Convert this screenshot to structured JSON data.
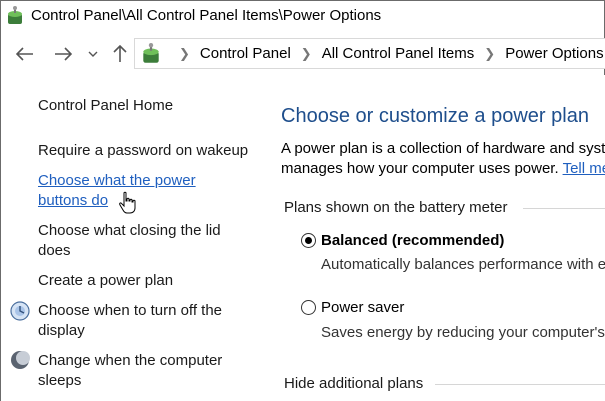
{
  "window": {
    "title": "Control Panel\\All Control Panel Items\\Power Options"
  },
  "navigation": {
    "back_icon": "arrow-left-icon",
    "forward_icon": "arrow-right-icon",
    "recent_icon": "chevron-down-icon",
    "up_icon": "arrow-up-icon"
  },
  "addressbar": {
    "icon": "control-panel-icon",
    "crumbs": [
      "Control Panel",
      "All Control Panel Items",
      "Power Options"
    ]
  },
  "sidebar": {
    "home": "Control Panel Home",
    "items": [
      {
        "label": "Require a password on wakeup"
      },
      {
        "label_lines": [
          "Choose what the power",
          "buttons do"
        ]
      },
      {
        "label_lines": [
          "Choose what closing the lid",
          "does"
        ]
      },
      {
        "label": "Create a power plan"
      },
      {
        "label_lines": [
          "Choose when to turn off the",
          "display"
        ],
        "icon": "display-icon"
      },
      {
        "label_lines": [
          "Change when the computer",
          "sleeps"
        ],
        "icon": "moon-icon"
      }
    ]
  },
  "main": {
    "heading": "Choose or customize a power plan",
    "description_line1": "A power plan is a collection of hardware and syst",
    "description_line2": "manages how your computer uses power.",
    "tell_me_link": "Tell me",
    "group_label": "Plans shown on the battery meter",
    "plans": [
      {
        "name": "Balanced (recommended)",
        "description": "Automatically balances performance with e",
        "selected": true
      },
      {
        "name": "Power saver",
        "description": "Saves energy by reducing your computer's",
        "selected": false
      }
    ],
    "hide_plans_label": "Hide additional plans"
  },
  "colors": {
    "link": "#1f5fbf",
    "heading": "#1e4e8c"
  }
}
